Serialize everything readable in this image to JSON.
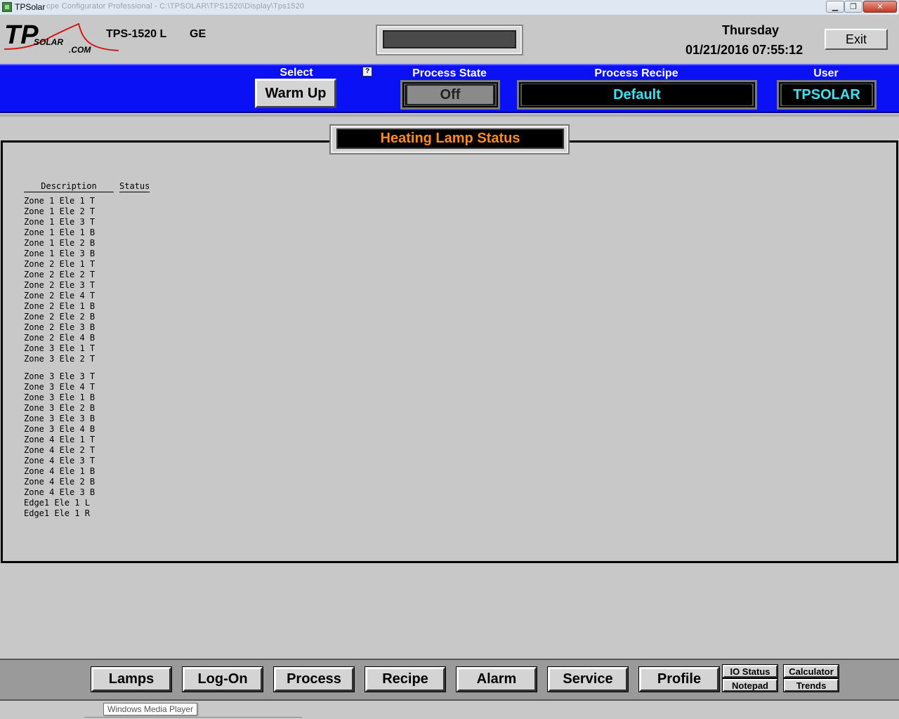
{
  "window": {
    "title": "TPSolar",
    "path": "cpe Configurator Professional - C:\\TPSOLAR\\TPS1520\\Display\\Tps1520",
    "controls": [
      "minimize",
      "maximize",
      "close"
    ]
  },
  "header": {
    "logo_text": "TP",
    "logo_sub1": "SOLAR",
    "logo_sub2": ".COM",
    "model": "TPS-1520 L",
    "site": "GE",
    "weekday": "Thursday",
    "datetime": "01/21/2016 07:55:12",
    "exit_label": "Exit"
  },
  "status_bar": {
    "select_label": "Select",
    "mode_button": "Warm Up",
    "help_label": "?",
    "process_state_label": "Process State",
    "process_state_value": "Off",
    "process_recipe_label": "Process Recipe",
    "process_recipe_value": "Default",
    "user_label": "User",
    "user_value": "TPSOLAR"
  },
  "panel": {
    "title": "Heating Lamp Status",
    "columns": [
      "Description",
      "Status"
    ],
    "rows": [
      "Zone 1 Ele 1 T",
      "Zone 1 Ele 2 T",
      "Zone 1 Ele 3 T",
      "Zone 1 Ele 1 B",
      "Zone 1 Ele 2 B",
      "Zone 1 Ele 3 B",
      "Zone 2 Ele 1 T",
      "Zone 2 Ele 2 T",
      "Zone 2 Ele 3 T",
      "Zone 2 Ele 4 T",
      "Zone 2 Ele 1 B",
      "Zone 2 Ele 2 B",
      "Zone 2 Ele 3 B",
      "Zone 2 Ele 4 B",
      "Zone 3 Ele 1 T",
      "Zone 3 Ele 2 T",
      "Zone 3 Ele 3 T",
      "Zone 3 Ele 4 T",
      "Zone 3 Ele 1 B",
      "Zone 3 Ele 2 B",
      "Zone 3 Ele 3 B",
      "Zone 3 Ele 4 B",
      "Zone 4 Ele 1 T",
      "Zone 4 Ele 2 T",
      "Zone 4 Ele 3 T",
      "Zone 4 Ele 1 B",
      "Zone 4 Ele 2 B",
      "Zone 4 Ele 3 B",
      "Edge1 Ele 1 L",
      "Edge1 Ele 1 R"
    ]
  },
  "nav": {
    "buttons": [
      "Lamps",
      "Log-On",
      "Process",
      "Recipe",
      "Alarm",
      "Service",
      "Profile"
    ],
    "small_buttons": [
      "IO Status",
      "Notepad",
      "Calculator",
      "Trends"
    ]
  },
  "taskbar": {
    "tooltip": "Windows Media Player"
  },
  "colors": {
    "status_bar": "#0a12f5",
    "recipe_text": "#3fe0f0",
    "panel_title_text": "#ff8c1a",
    "background": "#c8c8c8"
  }
}
